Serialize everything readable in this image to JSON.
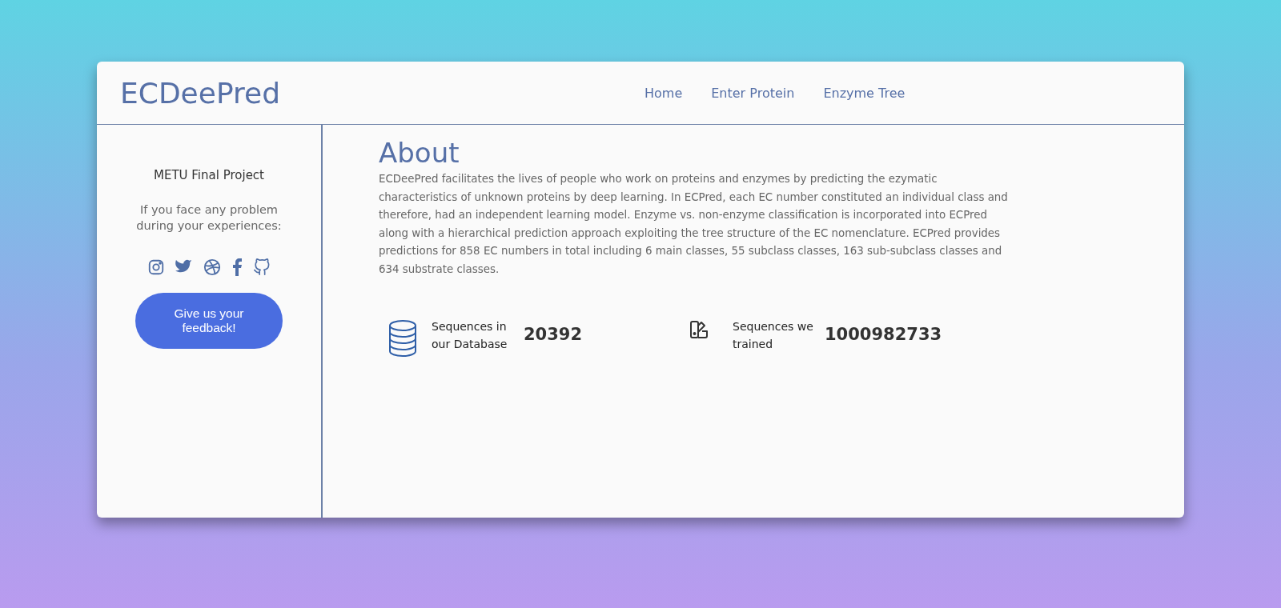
{
  "brand": "ECDeePred",
  "nav": [
    {
      "label": "Home"
    },
    {
      "label": "Enter Protein"
    },
    {
      "label": "Enzyme Tree"
    }
  ],
  "sidebar": {
    "title": "METU Final Project",
    "message": "If you face any problem during your experiences:",
    "social": [
      {
        "kind": "instagram"
      },
      {
        "kind": "twitter"
      },
      {
        "kind": "dribbble"
      },
      {
        "kind": "facebook"
      },
      {
        "kind": "github"
      }
    ],
    "button": "Give us your feedback!"
  },
  "about": {
    "heading": "About",
    "text": "ECDeePred facilitates the lives of people who work on proteins and enzymes by predicting the ezymatic characteristics of unknown proteins by deep learning. In ECPred, each EC number constituted an individual class and therefore, had an independent learning model. Enzyme vs. non-enzyme classification is incorporated into ECPred along with a hierarchical prediction approach exploiting the tree structure of the EC nomenclature. ECPred provides predictions for 858 EC numbers in total including 6 main classes, 55 subclass classes, 163 sub-subclass classes and 634 substrate classes."
  },
  "stats": [
    {
      "kind": "database",
      "label": "Sequences in our Database",
      "value": "20392"
    },
    {
      "kind": "swatch",
      "label": "Sequences we trained",
      "value": "1000982733"
    }
  ]
}
